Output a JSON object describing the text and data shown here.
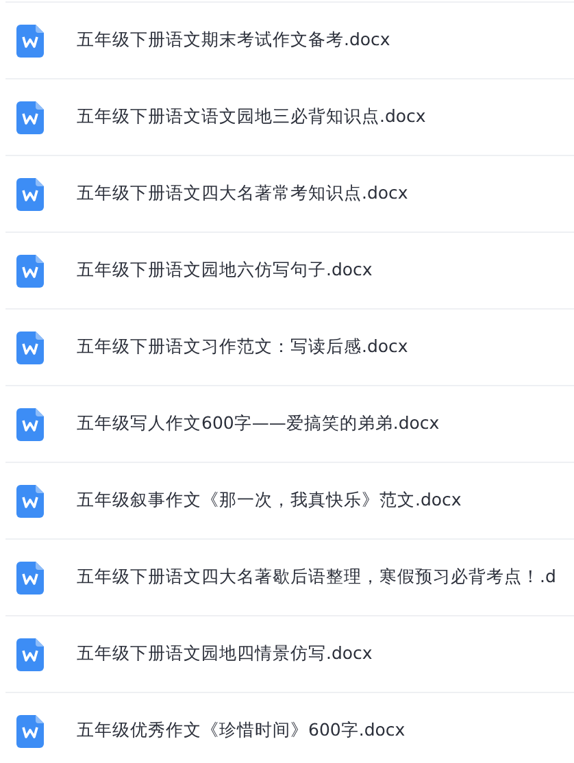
{
  "files": [
    {
      "name": "五年级下册语文期末考试作文备考.docx"
    },
    {
      "name": "五年级下册语文语文园地三必背知识点.docx"
    },
    {
      "name": "五年级下册语文四大名著常考知识点.docx"
    },
    {
      "name": "五年级下册语文园地六仿写句子.docx"
    },
    {
      "name": "五年级下册语文习作范文：写读后感.docx"
    },
    {
      "name": "五年级写人作文600字——爱搞笑的弟弟.docx"
    },
    {
      "name": "五年级叙事作文《那一次，我真快乐》范文.docx"
    },
    {
      "name": "五年级下册语文四大名著歇后语整理，寒假预习必背考点！.d"
    },
    {
      "name": "五年级下册语文园地四情景仿写.docx"
    },
    {
      "name": "五年级优秀作文《珍惜时间》600字.docx"
    }
  ]
}
